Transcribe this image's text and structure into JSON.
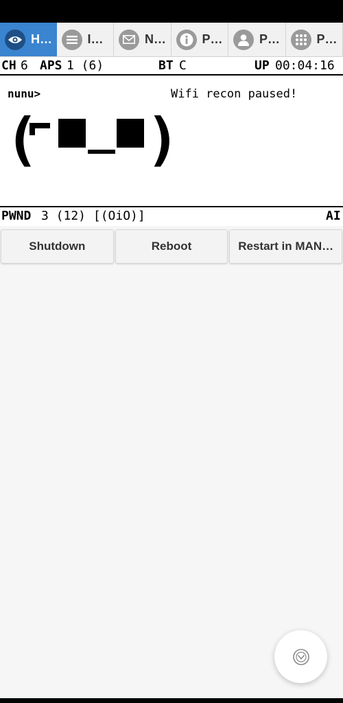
{
  "tabs": [
    {
      "label": "H…",
      "icon": "eye-icon"
    },
    {
      "label": "I…",
      "icon": "list-icon"
    },
    {
      "label": "N…",
      "icon": "mail-icon"
    },
    {
      "label": "P…",
      "icon": "info-icon"
    },
    {
      "label": "P…",
      "icon": "person-icon"
    },
    {
      "label": "P…",
      "icon": "grid-icon"
    }
  ],
  "screen": {
    "ch_label": "CH",
    "ch_value": "6",
    "aps_label": "APS",
    "aps_value": "1 (6)",
    "bt_label": "BT",
    "bt_value": "C",
    "up_label": "UP",
    "up_value": "00:04:16",
    "name": "nunu>",
    "status": "Wifi recon paused!",
    "face": "(⌐■_■)",
    "pwnd_label": "PWND",
    "pwnd_value": "3 (12) [(OiO)]",
    "mode": "AI"
  },
  "actions": {
    "shutdown": "Shutdown",
    "reboot": "Reboot",
    "restart": "Restart in MAN…"
  },
  "colors": {
    "accent": "#3b84cf",
    "accent_dark": "#1e4f86"
  }
}
